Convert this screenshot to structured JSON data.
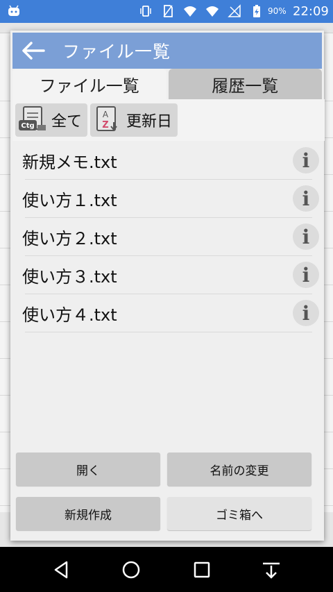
{
  "statusbar": {
    "battery": "90%",
    "time": "22:09"
  },
  "dialog": {
    "title": "ファイル一覧",
    "tabs": [
      {
        "label": "ファイル一覧",
        "active": true
      },
      {
        "label": "履歴一覧",
        "active": false
      }
    ],
    "filters": {
      "category_badge": "Ctg",
      "category_label": "全て",
      "sort_label": "更新日"
    },
    "files": [
      {
        "name": "新規メモ.txt"
      },
      {
        "name": "使い方１.txt"
      },
      {
        "name": "使い方２.txt"
      },
      {
        "name": "使い方３.txt"
      },
      {
        "name": "使い方４.txt"
      }
    ],
    "info_glyph": "i",
    "buttons": {
      "open": "開く",
      "rename": "名前の変更",
      "new": "新規作成",
      "trash": "ゴミ箱へ"
    }
  },
  "colors": {
    "statusbar": "#3f7fd8",
    "header": "#7b9fd6",
    "dialog_bg": "#efefef"
  }
}
